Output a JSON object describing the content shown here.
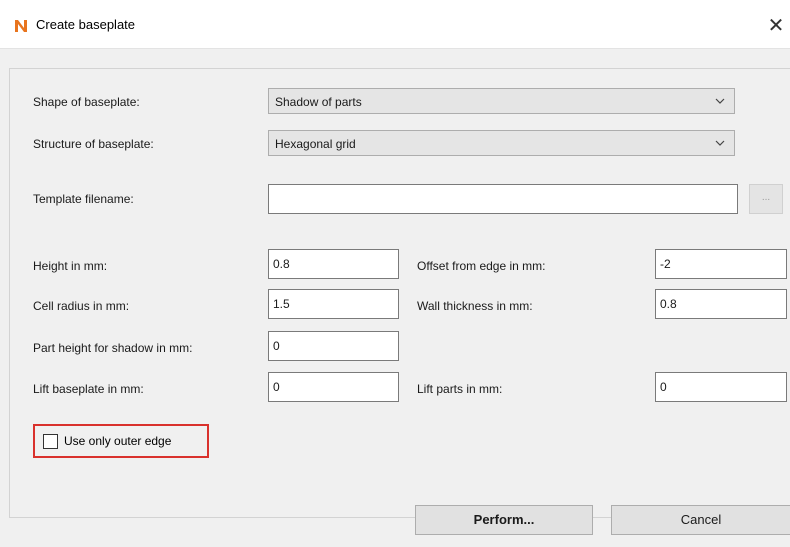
{
  "window": {
    "title": "Create baseplate",
    "close_symbol": "✕",
    "app_icon": "n-logo-icon",
    "app_icon_color": "#e8741e"
  },
  "form": {
    "shape_label": "Shape of baseplate:",
    "shape_value": "Shadow of parts",
    "structure_label": "Structure of baseplate:",
    "structure_value": "Hexagonal grid",
    "template_label": "Template filename:",
    "template_value": "",
    "browse_label": "...",
    "height_label": "Height in mm:",
    "height_value": "0.8",
    "offset_label": "Offset from edge in mm:",
    "offset_value": "-2",
    "cell_radius_label": "Cell radius in mm:",
    "cell_radius_value": "1.5",
    "wall_label": "Wall thickness in mm:",
    "wall_value": "0.8",
    "part_height_label": "Part height for shadow in mm:",
    "part_height_value": "0",
    "lift_baseplate_label": "Lift baseplate in mm:",
    "lift_baseplate_value": "0",
    "lift_parts_label": "Lift parts in mm:",
    "lift_parts_value": "0",
    "outer_edge_label": "Use only outer edge",
    "outer_edge_checked": false
  },
  "buttons": {
    "perform": "Perform...",
    "cancel": "Cancel"
  },
  "colors": {
    "highlight_border": "#d9312c",
    "dialog_bg": "#f0f0f0"
  }
}
